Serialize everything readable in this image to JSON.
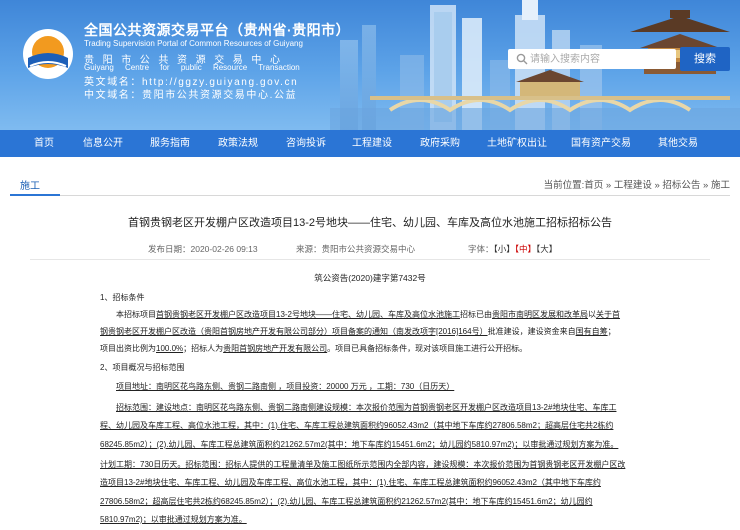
{
  "header": {
    "title": "全国公共资源交易平台（贵州省·贵阳市）",
    "title_en": "Trading Supervision Portal of Common Resources of Guiyang",
    "org_cn": "贵阳市公共资源交易中心",
    "org_en": "Guiyang Centre for public Resource Transaction",
    "domain_en": "英文域名：http://ggzy.guiyang.gov.cn",
    "domain_cn": "中文域名：贵阳市公共资源交易中心.公益"
  },
  "search": {
    "placeholder": "请输入搜索内容",
    "button": "搜索"
  },
  "nav": [
    "首页",
    "信息公开",
    "服务指南",
    "政策法规",
    "咨询投诉",
    "工程建设",
    "政府采购",
    "土地矿权出让",
    "国有资产交易",
    "其他交易"
  ],
  "breadcrumb": {
    "section": "施工",
    "prefix": "当前位置:",
    "items": [
      "首页",
      "工程建设",
      "招标公告",
      "施工"
    ],
    "sep": " » "
  },
  "article": {
    "title": "首钢贵钢老区开发棚户区改造项目13-2号地块——住宅、幼儿园、车库及高位水池施工招标招标公告",
    "published": "发布日期：2020-02-26 09:13",
    "source": "来源：贵阳市公共资源交易中心",
    "font_label": "字体：",
    "font_small": "【小】",
    "font_medium": "【中】",
    "font_large": "【大】",
    "doc_no": "筑公资告(2020)建字第7432号",
    "s1_heading": "1、招标条件",
    "s1_l1_a": "本招标项目",
    "s1_l1_b": "首钢贵钢老区开发棚户区改造项目13-2号地块——住宅、幼儿园、车库及高位水池施工",
    "s1_l1_c": "招标已由",
    "s1_l1_d": "贵阳市南明区发展和改革局",
    "s1_l1_e": "以",
    "s1_l1_f": "关于首",
    "s1_l2_a": "钢贵钢老区开发棚户区改造（贵阳首钢房地产开发有限公司部分）项目备案的通知（南发改项字[2016]164号）",
    "s1_l2_b": "批准建设，建设资金来自",
    "s1_l2_c": "国有自筹",
    "s1_l2_d": "；",
    "s1_l3_a": "项目出资比例为",
    "s1_l3_b": "100.0%",
    "s1_l3_c": "；招标人为",
    "s1_l3_d": "贵阳首钢房地产开发有限公司",
    "s1_l3_e": "。项目已具备招标条件，现对该项目施工进行公开招标。",
    "s2_heading": "2、项目概况与招标范围",
    "s2_l1": "项目地址：南明区花鸟路东侧、贵钢二路南侧 ，项目投资：20000 万元 ，工期：730（日历天）",
    "s2_l2": "招标范围：建设地点：南明区花鸟路东侧、贵钢二路南侧建设规模：本次报价范围为首钢贵钢老区开发棚户区改造项目13-2#地块住宅、车库工",
    "s2_l3": "程、幼儿园及车库工程、高位水池工程，其中：(1).住宅、车库工程总建筑面积约96052.43m2（其中地下车库约27806.58m2；超高层住宅共2栋约",
    "s2_l4": "68245.85m2）；(2).幼儿园、车库工程总建筑面积约21262.57m2(其中：地下车库约15451.6m2；幼儿园约5810.97m2)；以审批通过规划方案为准。",
    "s2_l5": "计划工期：730日历天。招标范围：招标人提供的工程量清单及施工图纸所示范围内全部内容，建设规模：本次报价范围为首钢贵钢老区开发棚户区改",
    "s2_l6": "造项目13-2#地块住宅、车库工程、幼儿园及车库工程、高位水池工程，其中：(1).住宅、车库工程总建筑面积约96052.43m2（其中地下车库约",
    "s2_l7": "27806.58m2；超高层住宅共2栋约68245.85m2）；(2).幼儿园、车库工程总建筑面积约21262.57m2(其中：地下车库约15451.6m2；幼儿园约",
    "s2_l8": "5810.97m2)；以审批通过规划方案为准。"
  },
  "colors": {
    "nav": "#2b75d5",
    "header_top": "#3f86d8",
    "search_btn": "#1f64c4",
    "link_blue": "#1a5fb4",
    "active_red": "#cc0000"
  }
}
